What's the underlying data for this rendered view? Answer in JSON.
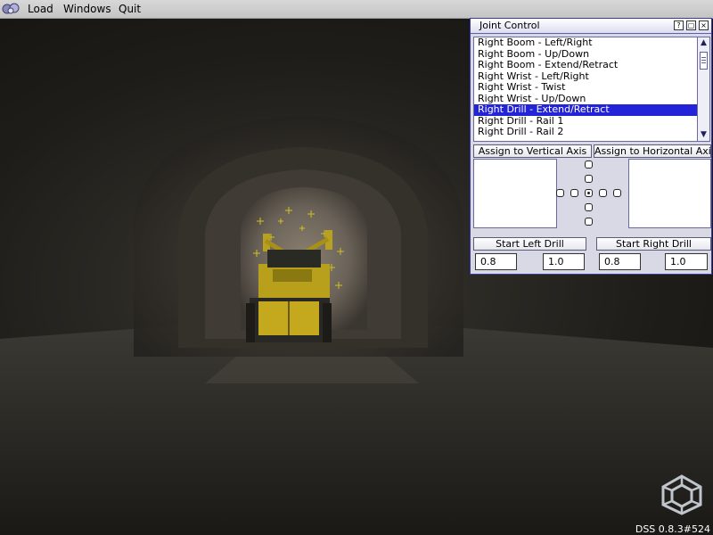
{
  "menubar": {
    "items": [
      "Load",
      "Windows",
      "Quit"
    ]
  },
  "joint_control": {
    "title": "Joint Control",
    "window_buttons": [
      "?",
      "▢",
      "×"
    ],
    "joints": [
      "Right Boom - Left/Right",
      "Right Boom - Up/Down",
      "Right Boom - Extend/Retract",
      "Right Wrist - Left/Right",
      "Right Wrist - Twist",
      "Right Wrist - Up/Down",
      "Right Drill - Extend/Retract",
      "Right Drill - Rail 1",
      "Right Drill - Rail 2"
    ],
    "selected_index": 6,
    "assign_vertical_label": "Assign to Vertical Axis",
    "assign_horizontal_label": "Assign to Horizontal Axis",
    "start_left_drill_label": "Start Left Drill",
    "start_right_drill_label": "Start Right Drill",
    "left_drill_values": [
      "0.8",
      "1.0"
    ],
    "right_drill_values": [
      "0.8",
      "1.0"
    ]
  },
  "status": {
    "version": "DSS 0.8.3#524"
  },
  "colors": {
    "selection": "#2323d8",
    "window_border": "#3a3aa0",
    "drill_yellow": "#c8b020"
  }
}
